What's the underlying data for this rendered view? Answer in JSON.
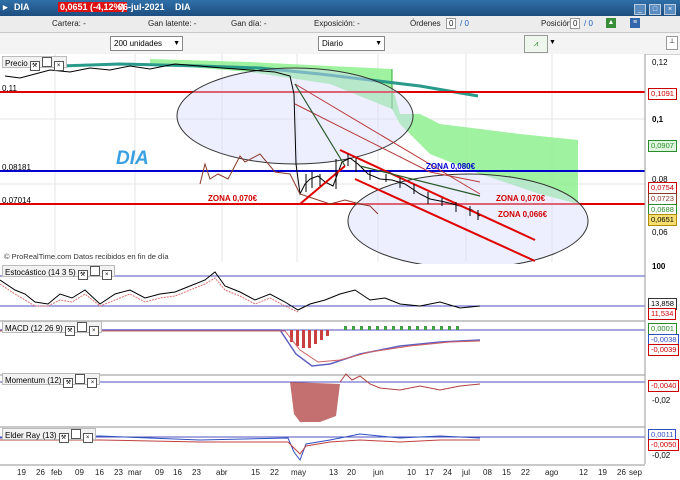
{
  "window": {
    "symbol": "DIA",
    "price": "0,0651 (-4,12%)",
    "date": "06-jul-2021",
    "name": "DIA"
  },
  "position_bar": {
    "cartera": "Cartera: -",
    "gan_latente": "Gan latente: -",
    "gan_dia": "Gan día: -",
    "exposicion": "Exposición: -",
    "ordenes_label": "Órdenes",
    "ordenes_value": "0",
    "ordenes_extra": "/ 0",
    "posicion_label": "Posición:",
    "posicion_value": "0",
    "posicion_extra": "/ 0"
  },
  "controls": {
    "units": "200 unidades",
    "period": "Diario"
  },
  "price_panel": {
    "label": "Precio",
    "watermark": "DIA",
    "source": "© ProRealTime.com  Datos recibidos en fin de día",
    "left_levels": [
      "0,11",
      "0,08181",
      "0,07014"
    ],
    "axis": [
      "0,12",
      "0,1",
      "0,08",
      "0,06"
    ],
    "tags": [
      "0,1091",
      "0,0907",
      "0,0754",
      "0,0723",
      "0,0688",
      "0,0651"
    ],
    "annotations": [
      "ZONA 0,080€",
      "ZONA 0,070€",
      "ZONA 0,070€",
      "ZONA 0,066€"
    ]
  },
  "stochastic": {
    "label": "Estocástico (14 3 5)",
    "axis_top": "100",
    "tags": [
      "13,858",
      "11,534"
    ]
  },
  "macd": {
    "label": "MACD (12 26 9)",
    "tags": [
      "0,0001",
      "-0,0038",
      "-0,0039"
    ]
  },
  "momentum": {
    "label": "Momentum (12)",
    "tags": [
      "-0,0040"
    ],
    "axis": "-0,02"
  },
  "elder": {
    "label": "Elder Ray (13)",
    "tags": [
      "0,0011",
      "-0,0050"
    ],
    "axis": "-0,02"
  },
  "x_axis": [
    "19",
    "26",
    "feb",
    "09",
    "16",
    "23",
    "mar",
    "09",
    "16",
    "23",
    "abr",
    "15",
    "22",
    "may",
    "13",
    "20",
    "jun",
    "10",
    "17",
    "24",
    "jul",
    "08",
    "15",
    "22",
    "ago",
    "12",
    "19",
    "26",
    "sep"
  ],
  "colors": {
    "red_line": "#e00000",
    "blue_line": "#0000d0",
    "cloud": "#8ef08e",
    "teal": "#2a9a8a"
  }
}
